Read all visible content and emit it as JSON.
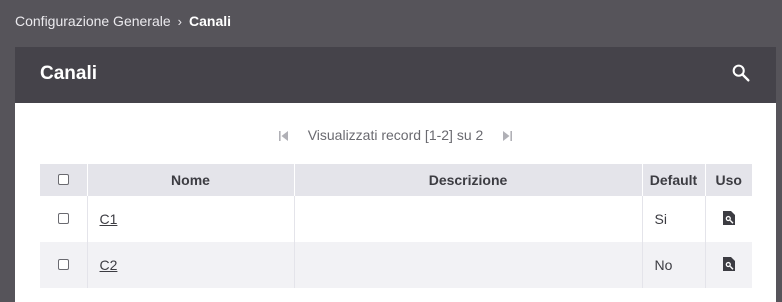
{
  "breadcrumb": {
    "parent": "Configurazione Generale",
    "separator": "›",
    "current": "Canali"
  },
  "panel": {
    "title": "Canali",
    "search_icon": "search-icon"
  },
  "pager": {
    "text": "Visualizzati record [1-2] su 2",
    "first_icon": "first-page-icon",
    "last_icon": "last-page-icon"
  },
  "table": {
    "columns": [
      "Nome",
      "Descrizione",
      "Default",
      "Uso"
    ],
    "rows": [
      {
        "nome": "C1",
        "descrizione": "",
        "default": "Si",
        "uso_icon": "document-search-icon"
      },
      {
        "nome": "C2",
        "descrizione": "",
        "default": "No",
        "uso_icon": "document-search-icon"
      }
    ]
  },
  "colors": {
    "background": "#56545a",
    "header": "#45434a",
    "table_header": "#e4e4ea"
  }
}
